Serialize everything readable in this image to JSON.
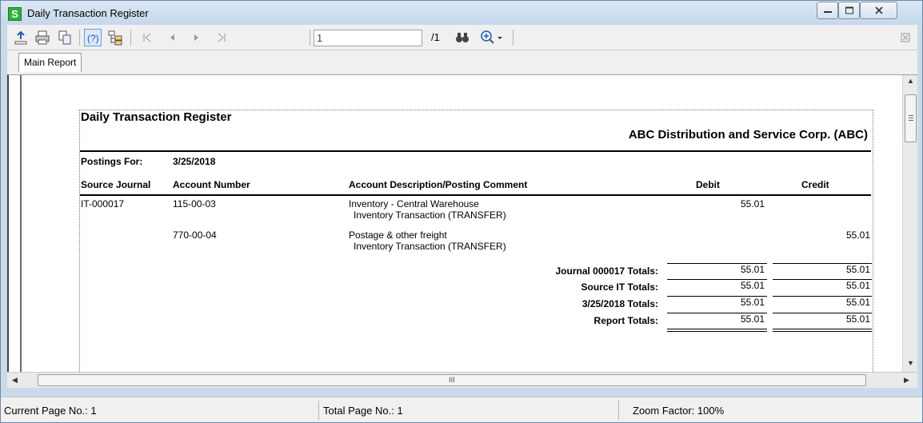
{
  "window": {
    "title": "Daily Transaction Register",
    "app_icon_letter": "S"
  },
  "toolbar": {
    "export_icon": "export-icon",
    "print_icon": "print-icon",
    "copy_icon": "copy-icon",
    "help_icon": "help-icon",
    "group_tree_icon": "group-tree-icon",
    "page_input_value": "1",
    "page_total": "/1",
    "search_icon": "binoculars-icon",
    "zoom_icon": "zoom-icon"
  },
  "tabs": [
    "Main Report"
  ],
  "report": {
    "title": "Daily Transaction Register",
    "company": "ABC Distribution and Service Corp. (ABC)",
    "postings_for_label": "Postings For:",
    "postings_for_date": "3/25/2018",
    "columns": {
      "source_journal": "Source Journal",
      "account_number": "Account Number",
      "description": "Account Description/Posting Comment",
      "debit": "Debit",
      "credit": "Credit"
    },
    "lines": [
      {
        "source_journal": "IT-000017",
        "account_number": "115-00-03",
        "description": "Inventory - Central Warehouse",
        "comment": "Inventory Transaction (TRANSFER)",
        "debit": "55.01",
        "credit": ""
      },
      {
        "source_journal": "",
        "account_number": "770-00-04",
        "description": "Postage & other freight",
        "comment": "Inventory Transaction (TRANSFER)",
        "debit": "",
        "credit": "55.01"
      }
    ],
    "totals": [
      {
        "label": "Journal 000017 Totals:",
        "debit": "55.01",
        "credit": "55.01"
      },
      {
        "label": "Source IT Totals:",
        "debit": "55.01",
        "credit": "55.01"
      },
      {
        "label": "3/25/2018 Totals:",
        "debit": "55.01",
        "credit": "55.01"
      },
      {
        "label": "Report Totals:",
        "debit": "55.01",
        "credit": "55.01"
      }
    ]
  },
  "hscroll": {
    "grip": "III"
  },
  "status": {
    "current_page": "Current Page No.: 1",
    "total_page": "Total Page No.: 1",
    "zoom": "Zoom Factor: 100%"
  }
}
